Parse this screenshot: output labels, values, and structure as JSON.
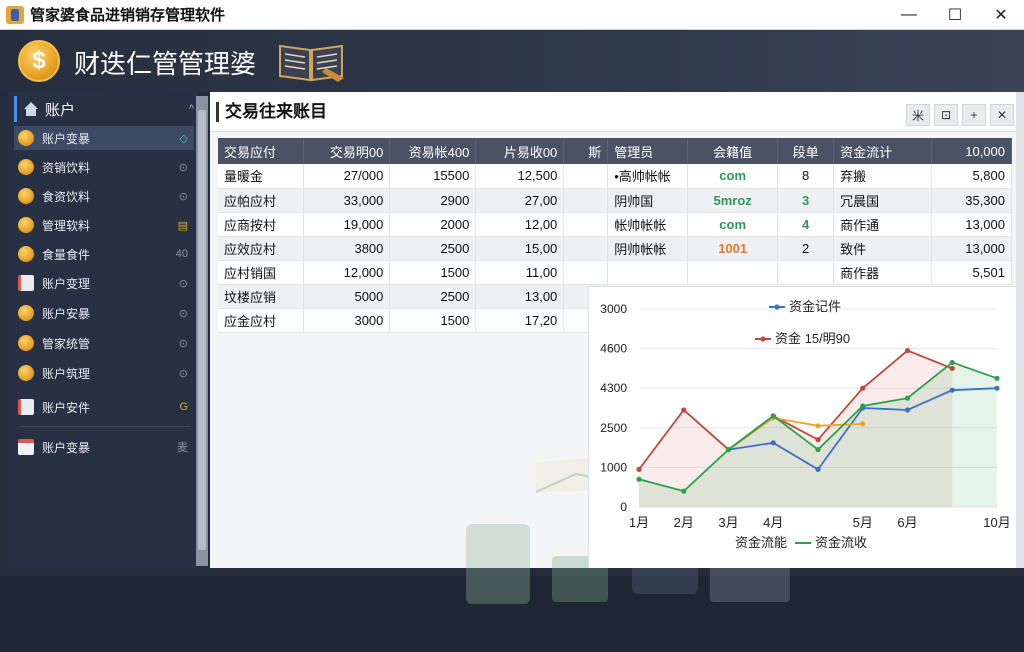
{
  "window": {
    "title": "管家婆食品进销销存管理软件",
    "minimize": "—",
    "maximize": "☐",
    "close": "✕"
  },
  "header": {
    "coin_glyph": "$",
    "brand": "财迭仁管管理婆"
  },
  "sidebar": {
    "head_label": "账户",
    "head_caret": "^",
    "items": [
      {
        "label": "账户变暴",
        "icon": "coin-icon",
        "tail": "◇",
        "active": true
      },
      {
        "label": "资销饮料",
        "icon": "coin-icon",
        "tail": "⊙"
      },
      {
        "label": "食资饮料",
        "icon": "coin-icon",
        "tail": "⊙"
      },
      {
        "label": "管理软料",
        "icon": "coin-icon",
        "tail": "▤"
      },
      {
        "label": "食量食件",
        "icon": "coin-icon",
        "tail": "40"
      },
      {
        "label": "账户变理",
        "icon": "chart-doc-icon",
        "tail": "⊙"
      },
      {
        "label": "账户安暴",
        "icon": "coin-icon",
        "tail": "⊙"
      },
      {
        "label": "管家统管",
        "icon": "coin-icon",
        "tail": "⊙"
      },
      {
        "label": "账户筑理",
        "icon": "coin-icon",
        "tail": "⊙"
      },
      {
        "label": "账户安件",
        "icon": "edit-doc-icon",
        "tail": "G"
      },
      {
        "label": "账户变暴",
        "icon": "calendar-icon",
        "tail": "麦"
      }
    ]
  },
  "panel": {
    "title": "交易往来账目",
    "buttons": [
      "⽶",
      "⊡",
      "+",
      "✕"
    ]
  },
  "table": {
    "headers": [
      "交易应付",
      "交易明00",
      "资易帐400",
      "片易收00",
      "斯",
      "管理员",
      "会籍值",
      "段单",
      "资金流计",
      "10,000"
    ],
    "rows": [
      [
        "量暖金",
        "27/000",
        "15500",
        "12,500",
        "",
        "•高帅帐帐",
        "com",
        "8",
        "弃搬",
        "5,800"
      ],
      [
        "应帕应村",
        "33,000",
        "2900",
        "27,00",
        "",
        "阴帅国",
        "5mroz",
        "3",
        "冗晨国",
        "35,300"
      ],
      [
        "应商按村",
        "19,000",
        "2000",
        "12,00",
        "",
        "帐帅帐帐",
        "com",
        "4",
        "商作通",
        "13,000"
      ],
      [
        "应效应村",
        "3800",
        "2500",
        "15,00",
        "",
        "阴帅帐帐",
        "1001",
        "2",
        "致件",
        "13,000"
      ],
      [
        "应村销国",
        "12,000",
        "1500",
        "11,00",
        "",
        "",
        "",
        "",
        "商作器",
        "5,501"
      ],
      [
        "坟楼应销",
        "5000",
        "2500",
        "13,00",
        "",
        "",
        "",
        "",
        "",
        ""
      ],
      [
        "应金应村",
        "3000",
        "1500",
        "17,20",
        "",
        "",
        "",
        "",
        "",
        ""
      ]
    ]
  },
  "colors": {
    "blue_series": "#3f6fc6",
    "red_series": "#c0473b",
    "green_series": "#2aa24a",
    "orange_series": "#e8a32a"
  },
  "chart_data": {
    "type": "line",
    "legend_top": [
      "资金记件",
      "资金 15/明90"
    ],
    "legend_bottom": [
      "资金流能",
      "资金流收"
    ],
    "categories": [
      "1月",
      "2月",
      "3月",
      "4月",
      "5月",
      "6月",
      "10月"
    ],
    "y_ticks": [
      "3000",
      "4600",
      "4300",
      "2500",
      "1000",
      "0"
    ],
    "series": [
      {
        "name": "资金记件",
        "color": "blue",
        "points": [
          [
            3,
            1450
          ],
          [
            4,
            1620
          ],
          [
            5,
            950
          ],
          [
            6,
            2500
          ],
          [
            7,
            2450
          ],
          [
            8,
            2950
          ],
          [
            9,
            3000
          ]
        ]
      },
      {
        "name": "资金 15/明90",
        "color": "red",
        "points": [
          [
            1,
            950
          ],
          [
            2,
            2450
          ],
          [
            3,
            1450
          ],
          [
            4,
            2300
          ],
          [
            5,
            1700
          ],
          [
            6,
            3000
          ],
          [
            7,
            3950
          ],
          [
            8,
            3500
          ]
        ]
      },
      {
        "color": "orange",
        "points": [
          [
            3,
            1450
          ],
          [
            4,
            2250
          ],
          [
            5,
            2050
          ],
          [
            6,
            2100
          ]
        ]
      },
      {
        "name": "资金流收",
        "color": "green",
        "points": [
          [
            1,
            700
          ],
          [
            2,
            400
          ],
          [
            3,
            1450
          ],
          [
            4,
            2300
          ],
          [
            5,
            1450
          ],
          [
            6,
            2550
          ],
          [
            7,
            2750
          ],
          [
            8,
            3650
          ],
          [
            9,
            3250
          ]
        ]
      }
    ]
  }
}
